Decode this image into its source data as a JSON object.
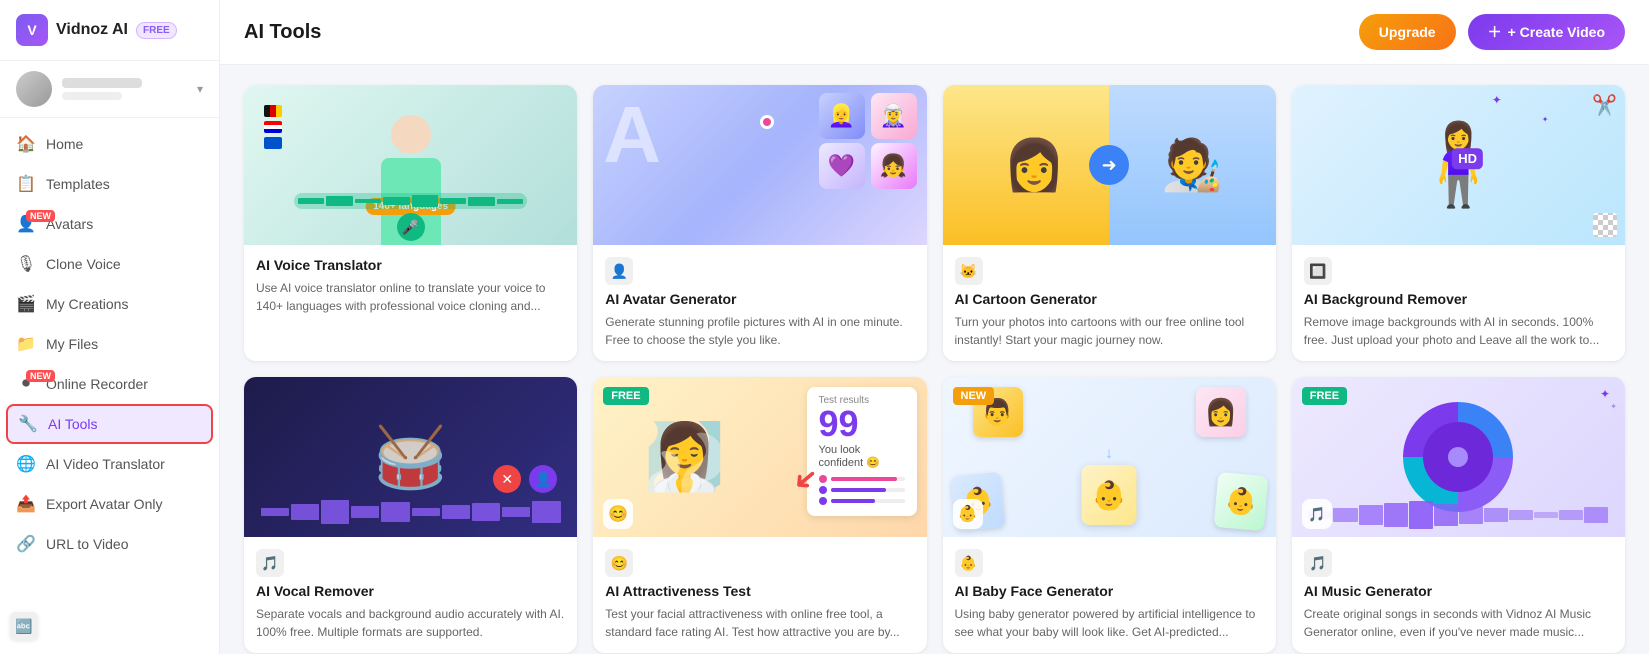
{
  "app": {
    "name": "Vidnoz AI",
    "plan": "FREE"
  },
  "header": {
    "title": "AI Tools",
    "upgrade_label": "Upgrade",
    "create_video_label": "+ Create Video"
  },
  "sidebar": {
    "nav_items": [
      {
        "id": "home",
        "label": "Home",
        "icon": "🏠",
        "has_new": false,
        "active": false
      },
      {
        "id": "templates",
        "label": "Templates",
        "icon": "📋",
        "has_new": false,
        "active": false
      },
      {
        "id": "avatars",
        "label": "Avatars",
        "icon": "👤",
        "has_new": true,
        "active": false
      },
      {
        "id": "clone-voice",
        "label": "Clone Voice",
        "icon": "🎙",
        "has_new": false,
        "active": false
      },
      {
        "id": "my-creations",
        "label": "My Creations",
        "icon": "🎬",
        "has_new": false,
        "active": false
      },
      {
        "id": "my-files",
        "label": "My Files",
        "icon": "📁",
        "has_new": false,
        "active": false
      },
      {
        "id": "online-recorder",
        "label": "Online Recorder",
        "icon": "⏺",
        "has_new": true,
        "active": false
      },
      {
        "id": "ai-tools",
        "label": "AI Tools",
        "icon": "🔧",
        "has_new": false,
        "active": true
      },
      {
        "id": "ai-video-translator",
        "label": "AI Video Translator",
        "icon": "🌐",
        "has_new": false,
        "active": false
      },
      {
        "id": "export-avatar-only",
        "label": "Export Avatar Only",
        "icon": "📤",
        "has_new": false,
        "active": false
      },
      {
        "id": "url-to-video",
        "label": "URL to Video",
        "icon": "🔗",
        "has_new": false,
        "active": false
      }
    ]
  },
  "tools": {
    "row1": [
      {
        "id": "ai-voice-translator",
        "title": "AI Voice Translator",
        "description": "Use AI voice translator online to translate your voice to 140+ languages with professional voice cloning and...",
        "badge": null,
        "icon": "🔤"
      },
      {
        "id": "ai-avatar-generator",
        "title": "AI Avatar Generator",
        "description": "Generate stunning profile pictures with AI in one minute. Free to choose the style you like.",
        "badge": null,
        "icon": "👤"
      },
      {
        "id": "ai-cartoon-generator",
        "title": "AI Cartoon Generator",
        "description": "Turn your photos into cartoons with our free online tool instantly! Start your magic journey now.",
        "badge": null,
        "icon": "🐱"
      },
      {
        "id": "ai-background-remover",
        "title": "AI Background Remover",
        "description": "Remove image backgrounds with AI in seconds. 100% free. Just upload your photo and Leave all the work to...",
        "badge": null,
        "icon": "🔲"
      }
    ],
    "row2": [
      {
        "id": "ai-vocal-remover",
        "title": "AI Vocal Remover",
        "description": "Separate vocals and background audio accurately with AI. 100% free. Multiple formats are supported.",
        "badge": null,
        "icon": "🎵"
      },
      {
        "id": "ai-attractiveness-test",
        "title": "AI Attractiveness Test",
        "description": "Test your facial attractiveness with online free tool, a standard face rating AI. Test how attractive you are by...",
        "badge": "FREE",
        "icon": "😊"
      },
      {
        "id": "ai-baby-face-generator",
        "title": "AI Baby Face Generator",
        "description": "Using baby generator powered by artificial intelligence to see what your baby will look like. Get AI-predicted...",
        "badge": "NEW",
        "icon": "👶"
      },
      {
        "id": "ai-music-generator",
        "title": "AI Music Generator",
        "description": "Create original songs in seconds with Vidnoz AI Music Generator online, even if you've never made music...",
        "badge": "FREE",
        "icon": "🎵"
      }
    ]
  },
  "score": {
    "label": "Test results",
    "value": "99",
    "sub_label": "You look confident 😊",
    "bars": [
      {
        "color": "#ec4899",
        "width": "90%"
      },
      {
        "color": "#7c3aed",
        "width": "75%"
      },
      {
        "color": "#7c3aed",
        "width": "60%"
      }
    ]
  }
}
